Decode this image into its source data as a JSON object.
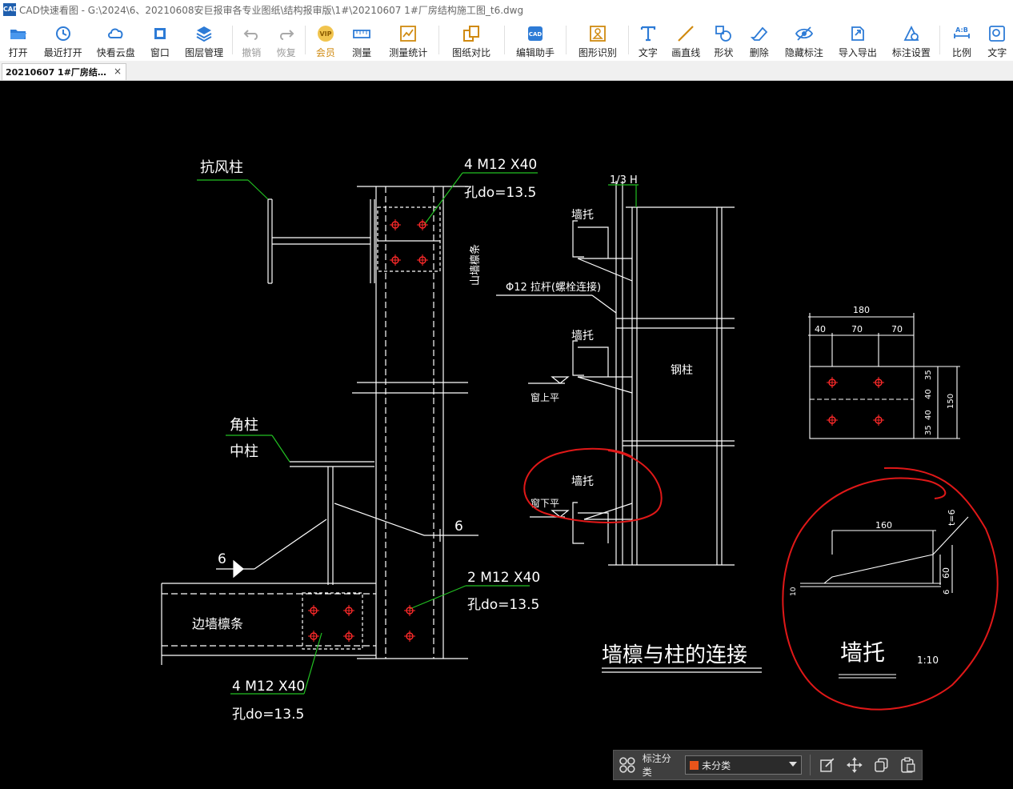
{
  "window": {
    "app_icon_text": "CAD",
    "title": "CAD快速看图 - G:\\2024\\6、20210608安巨报审各专业图纸\\结构报审版\\1#\\20210607   1#厂房结构施工图_t6.dwg"
  },
  "toolbar": {
    "items": [
      {
        "label": "打开",
        "icon": "folder-open-icon"
      },
      {
        "label": "最近打开",
        "icon": "history-icon"
      },
      {
        "label": "快看云盘",
        "icon": "cloud-icon"
      },
      {
        "label": "窗口",
        "icon": "window-icon"
      },
      {
        "label": "图层管理",
        "icon": "layers-icon"
      },
      {
        "label": "撤销",
        "icon": "undo-icon"
      },
      {
        "label": "恢复",
        "icon": "redo-icon"
      },
      {
        "label": "会员",
        "icon": "vip-icon",
        "badge": "VIP"
      },
      {
        "label": "测量",
        "icon": "ruler-icon"
      },
      {
        "label": "测量统计",
        "icon": "measure-stats-icon"
      },
      {
        "label": "图纸对比",
        "icon": "compare-icon"
      },
      {
        "label": "编辑助手",
        "icon": "edit-assistant-icon",
        "badge": "CAD"
      },
      {
        "label": "图形识别",
        "icon": "shape-recognition-icon"
      },
      {
        "label": "文字",
        "icon": "text-icon"
      },
      {
        "label": "画直线",
        "icon": "line-icon"
      },
      {
        "label": "形状",
        "icon": "shape-icon"
      },
      {
        "label": "删除",
        "icon": "eraser-icon"
      },
      {
        "label": "隐藏标注",
        "icon": "hide-annotation-icon"
      },
      {
        "label": "导入导出",
        "icon": "import-export-icon"
      },
      {
        "label": "标注设置",
        "icon": "annotation-settings-icon"
      },
      {
        "label": "比例",
        "icon": "scale-icon",
        "badge": "A:B"
      },
      {
        "label": "文字",
        "icon": "text-search-icon"
      }
    ]
  },
  "tabs": {
    "active": {
      "label": "20210607   1#厂房结…",
      "close": "×"
    }
  },
  "drawing": {
    "labels": {
      "kangfengzhu": "抗风柱",
      "bolt_top": "4 M12 X40",
      "hole_top": "孔do=13.5",
      "shanqianglintiao": "山墙檩条",
      "jiaozhu": "角柱",
      "zhongzhu": "中柱",
      "weld_6_a": "6",
      "weld_6_b": "6",
      "bianqianglintiao": "边墙檩条",
      "bolt_mid": "2 M12 X40",
      "hole_mid": "孔do=13.5",
      "bolt_bot": "4 M12 X40",
      "hole_bot": "孔do=13.5",
      "dim_13h": "1/3 H",
      "qiangtuo_1": "墙托",
      "lagan": "Φ12 拉杆(螺栓连接)",
      "qiangtuo_2": "墙托",
      "gangzhu": "钢柱",
      "chuangshangping": "窗上平",
      "qiangtuo_3": "墙托",
      "chuangxiaping": "窗下平",
      "section_title": "墙檩与柱的连接",
      "plate_180": "180",
      "plate_40": "40",
      "plate_70a": "70",
      "plate_70b": "70",
      "plate_35a": "35",
      "plate_40a": "40",
      "plate_40b": "40",
      "plate_35b": "35",
      "plate_150": "150",
      "detail_160": "160",
      "detail_t6": "t=6",
      "detail_60": "60",
      "detail_6": "6",
      "detail_10": "10",
      "qiangtuo_title": "墙托",
      "qiangtuo_scale": "1:10"
    },
    "colors": {
      "line": "#ffffff",
      "leader": "#22c022",
      "bolt": "#ff2a2a",
      "markup": "#e01818"
    }
  },
  "annotation_bar": {
    "grid_icon": "grid-icon",
    "label": "标注分类",
    "select_value": "未分类",
    "swatch_color": "#e8541a",
    "tools": [
      "edit-icon",
      "move-icon",
      "copy-icon",
      "paste-icon"
    ]
  }
}
